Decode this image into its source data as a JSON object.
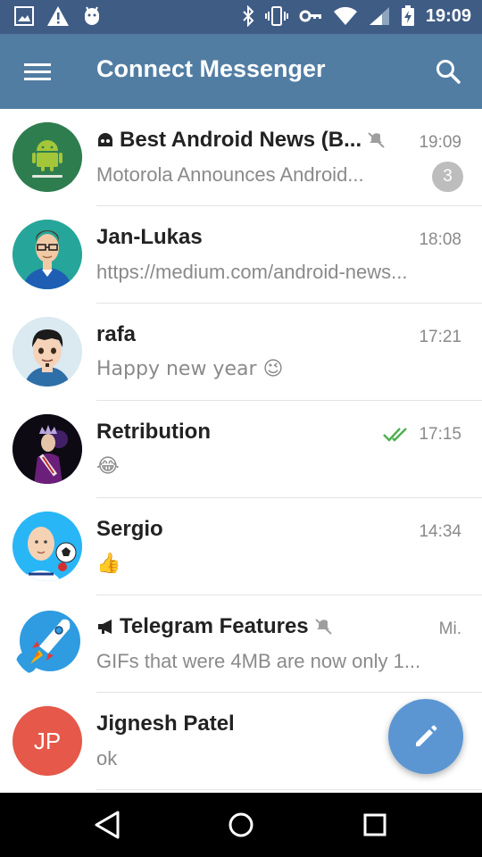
{
  "status_bar": {
    "time": "19:09",
    "left_icons": [
      "image-icon",
      "warning-icon",
      "android-icon"
    ],
    "right_icons": [
      "bluetooth-icon",
      "vibrate-icon",
      "key-icon",
      "wifi-icon",
      "signal-icon",
      "battery-charging-icon"
    ]
  },
  "app_bar": {
    "title": "Connect Messenger",
    "menu_icon": "menu-icon",
    "search_icon": "search-icon",
    "color": "#527da3"
  },
  "chats": [
    {
      "name": "Best Android News (B...",
      "type_icon": "bot-icon",
      "muted": true,
      "time": "19:09",
      "preview": "Motorola Announces Android...",
      "unread": "3",
      "avatar": "android-logo",
      "avatar_color": "#2e7d4f"
    },
    {
      "name": "Jan-Lukas",
      "time": "18:08",
      "preview": "https://medium.com/android-news...",
      "avatar": "man-glasses",
      "avatar_color": "#26a69a"
    },
    {
      "name": "rafa",
      "time": "17:21",
      "preview": "Happy new year 😉",
      "avatar": "cartoon-man",
      "avatar_color": "#cfe3ee"
    },
    {
      "name": "Retribution",
      "time": "17:15",
      "read_receipt": "double-check-icon",
      "preview": "😂",
      "avatar": "king-figure",
      "avatar_color": "#1a1026"
    },
    {
      "name": "Sergio",
      "time": "14:34",
      "preview": "👍",
      "avatar": "bald-man-soccer",
      "avatar_color": "#29b6f6"
    },
    {
      "name": "Telegram Features",
      "type_icon": "megaphone-icon",
      "muted": true,
      "time": "Mi.",
      "preview": "GIFs that were 4MB are now only 1...",
      "avatar": "rocket",
      "avatar_color": "#2f9be0"
    },
    {
      "name": "Jignesh Patel",
      "time": "",
      "preview": "ok",
      "avatar": "initials",
      "initials": "JP",
      "avatar_color": "#e5584a"
    }
  ],
  "fab": {
    "icon": "pencil-icon",
    "color": "#5b96d3"
  },
  "nav_bar": {
    "icons": [
      "back-icon",
      "home-icon",
      "recents-icon"
    ]
  }
}
